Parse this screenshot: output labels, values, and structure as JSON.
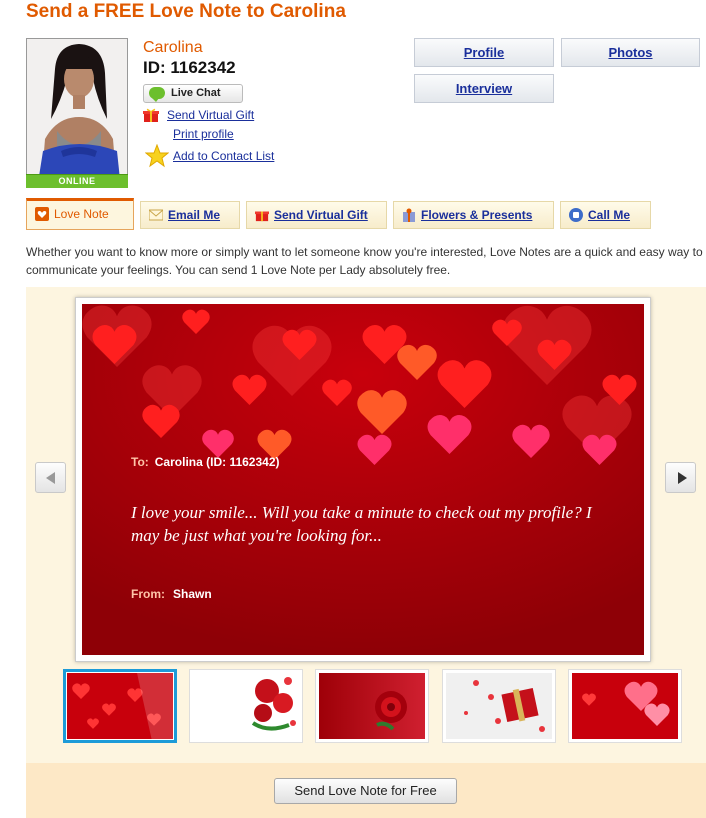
{
  "page": {
    "title": "Send a FREE Love Note to Carolina"
  },
  "profile": {
    "name": "Carolina",
    "id_text": "ID: 1162342",
    "online_badge": "ONLINE",
    "live_chat_label": "Live Chat",
    "send_gift_label": "Send Virtual Gift",
    "print_label": "Print profile",
    "contact_label": "Add to Contact List"
  },
  "nav": {
    "profile": "Profile",
    "photos": "Photos",
    "interview": "Interview"
  },
  "actions": {
    "love_note": "Love Note",
    "email_me": "Email Me",
    "send_gift": "Send Virtual Gift",
    "flowers": "Flowers & Presents",
    "call_me": "Call Me"
  },
  "intro": "Whether you want to know more or simply want to let someone know you're interested, Love Notes are a quick and easy way to communicate your feelings. You can send 1 Love Note per Lady absolutely free.",
  "card": {
    "to_label": "To:",
    "to_value": "Carolina (ID: 1162342)",
    "message": "I love your smile... Will you take a minute to check out my profile? I may be just what you're looking for...",
    "from_label": "From:",
    "from_value": "Shawn"
  },
  "thumbnails": [
    {
      "name": "red-hearts",
      "selected": true
    },
    {
      "name": "roses-on-white",
      "selected": false
    },
    {
      "name": "single-rose",
      "selected": false
    },
    {
      "name": "gift-box-hearts",
      "selected": false
    },
    {
      "name": "glossy-hearts",
      "selected": false
    }
  ],
  "footer": {
    "send_button": "Send Love Note for Free"
  },
  "colors": {
    "accent": "#e05a00",
    "link": "#1a2f9b",
    "online": "#6cbf2d",
    "selected_thumb": "#1d9bd8"
  }
}
